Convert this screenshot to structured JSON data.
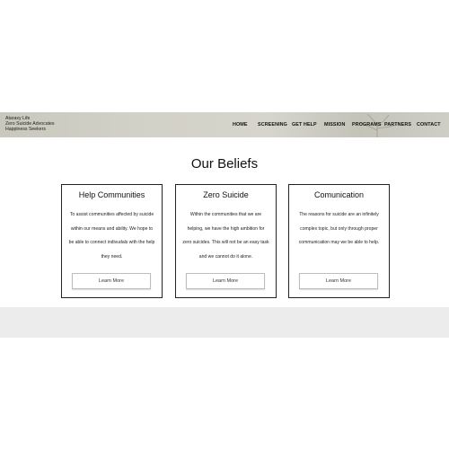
{
  "brand": {
    "lines": [
      "Ataraxy Life",
      "Zero Suicide Advocates",
      "Happiness Seekers"
    ]
  },
  "nav": {
    "items": [
      "HOME",
      "SCREENING",
      "GET HELP",
      "MISSION",
      "PROGRAMS",
      "PARTNERS",
      "CONTACT"
    ]
  },
  "main": {
    "heading": "Our Beliefs",
    "cards": [
      {
        "title": "Help Communities",
        "text": "To assist communities affected by suicide within our means and ability. We hope to be able to connect indivudals with the help they need.",
        "button": "Learn More"
      },
      {
        "title": "Zero Suicide",
        "text": "Within the communities that we are helping, we have the high ambition for zero suicides. This will not be an easy task and we cannot do it alone.",
        "button": "Learn More"
      },
      {
        "title": "Comunication",
        "text": "The reasons for suicide are an infinitely complex topic, but only through proper communication may we be able to help.",
        "button": "Learn More"
      }
    ]
  },
  "colors": {
    "header_bg": "#d2d1c7",
    "footer_bg": "#ececec",
    "card_border": "#222222",
    "button_border": "#bdbdbd"
  }
}
